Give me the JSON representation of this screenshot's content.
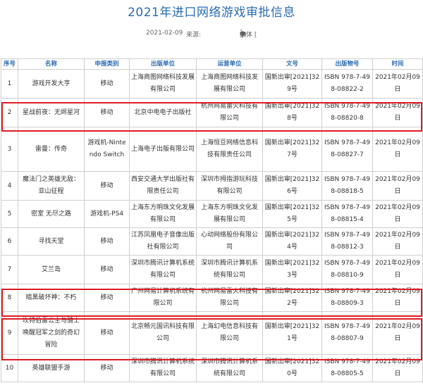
{
  "title": "2021年进口网络游戏审批信息",
  "meta": {
    "date": "2021-02-09",
    "source_label": "来源:",
    "font_label": "字体 [",
    "font_large": "大",
    "font_medium": "中",
    "font_small": "小",
    "font_close": "]"
  },
  "table": {
    "headers": [
      "序号",
      "名称",
      "申报类别",
      "出版单位",
      "运营单位",
      "文号",
      "出版物号",
      "时间"
    ],
    "rows": [
      {
        "no": "1",
        "name": "游戏开发大亨",
        "category": "移动",
        "publisher": "上海商图网络科技发展有限公司",
        "operator": "上海商图网络科技发展有限公司",
        "doc": "国新出审[2021]329号",
        "isbn": "ISBN 978-7-498-08822-2",
        "time": "2021年02月09日"
      },
      {
        "no": "2",
        "name": "星战前夜：无烬星河",
        "category": "移动",
        "publisher": "北京中电电子出版社",
        "operator": "杭州网易雷火科技有限公司",
        "doc": "国新出审[2021]328号",
        "isbn": "ISBN 978-7-498-08820-8",
        "time": "2021年02月09日"
      },
      {
        "no": "3",
        "name": "雷曼：传奇",
        "category": "游戏机-Nintendo Switch",
        "publisher": "上海电子出版有限公司",
        "operator": "上海恒豆网络信息科技有限责任公司",
        "doc": "国新出审[2021]327号",
        "isbn": "ISBN 978-7-498-08827-7",
        "time": "2021年02月09日"
      },
      {
        "no": "4",
        "name": "魔法门之英雄无敌：亚山征程",
        "category": "移动",
        "publisher": "西安交通大学出版社有限责任公司",
        "operator": "深圳市拇指游玩科技有限公司",
        "doc": "国新出审[2021]326号",
        "isbn": "ISBN 978-7-498-08818-5",
        "time": "2021年02月09日"
      },
      {
        "no": "5",
        "name": "密室 无尽之路",
        "category": "游戏机-PS4",
        "publisher": "上海东方明珠文化发展有限公司",
        "operator": "上海东方明珠文化发展有限公司",
        "doc": "国新出审[2021]325号",
        "isbn": "ISBN 978-7-498-08815-4",
        "time": "2021年02月09日"
      },
      {
        "no": "6",
        "name": "寻找天堂",
        "category": "移动",
        "publisher": "江苏凤凰电子音像出版社有限公司",
        "operator": "心动网络股份有限公司",
        "doc": "国新出审[2021]324号",
        "isbn": "ISBN 978-7-498-08812-3",
        "time": "2021年02月09日"
      },
      {
        "no": "7",
        "name": "艾兰岛",
        "category": "移动",
        "publisher": "深圳市腾讯计算机系统有限公司",
        "operator": "深圳市腾讯计算机系统有限公司",
        "doc": "国新出审[2021]323号",
        "isbn": "ISBN 978-7-498-08810-9",
        "time": "2021年02月09日"
      },
      {
        "no": "8",
        "name": "暗黑破坏神：不朽",
        "category": "移动",
        "publisher": "广州网易计算机系统有限公司",
        "operator": "杭州网易雷火科技有限公司",
        "doc": "国新出审[2021]322号",
        "isbn": "ISBN 978-7-498-08809-3",
        "time": "2021年02月09日"
      },
      {
        "no": "9",
        "name": "坎特伯雷公主与骑士唤醒冠军之剑的奇幻冒险",
        "category": "移动",
        "publisher": "北京畅元国讯科技有限公司",
        "operator": "上海幻电信息科技有限公司",
        "doc": "国新出审[2021]321号",
        "isbn": "ISBN 978-7-498-08807-9",
        "time": "2021年02月09日"
      },
      {
        "no": "10",
        "name": "英雄联盟手游",
        "category": "移动",
        "publisher": "深圳市腾讯计算机系统有限公司",
        "operator": "深圳市腾讯计算机系统有限公司",
        "doc": "国新出审[2021]320号",
        "isbn": "ISBN 978-7-498-08805-5",
        "time": "2021年02月09日"
      }
    ]
  }
}
